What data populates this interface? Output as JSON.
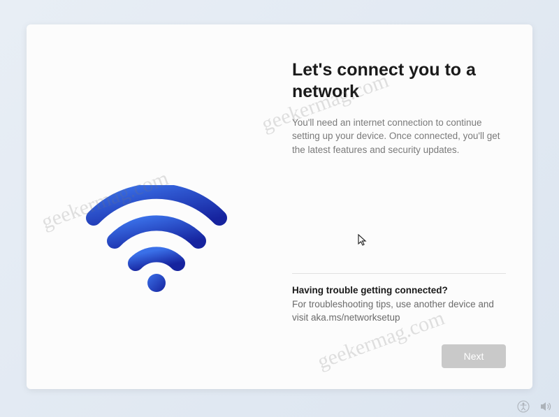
{
  "title": "Let's connect you to a network",
  "description": "You'll need an internet connection to continue setting up your device. Once connected, you'll get the latest features and security updates.",
  "trouble": {
    "heading": "Having trouble getting connected?",
    "text": "For troubleshooting tips, use another device and visit aka.ms/networksetup"
  },
  "buttons": {
    "next": "Next"
  },
  "watermark": "geekermag.com",
  "colors": {
    "wifi_gradient_start": "#2f5fd6",
    "wifi_gradient_end": "#1a2d9c"
  }
}
